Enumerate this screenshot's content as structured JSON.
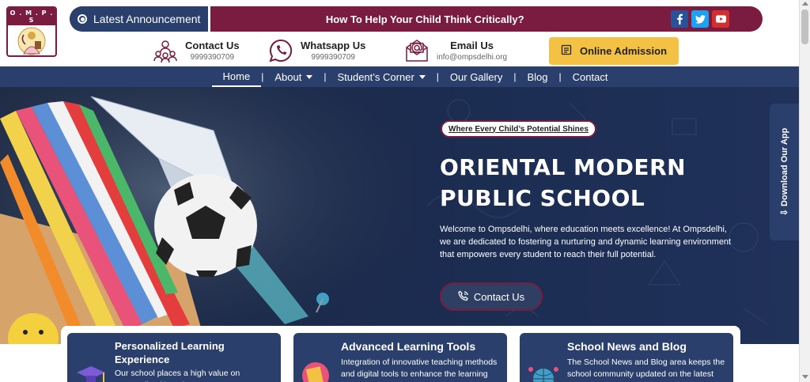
{
  "logo": {
    "top_text": "O . M . P . S",
    "bottom_text": "GOVT. RECOGNISED"
  },
  "announcement": {
    "label": "Latest Announcement",
    "text": "How To Help Your Child Think Critically?"
  },
  "socials": [
    {
      "name": "facebook",
      "glyph": "f"
    },
    {
      "name": "twitter",
      "glyph": "t"
    },
    {
      "name": "youtube",
      "glyph": "▶"
    }
  ],
  "contacts": [
    {
      "title": "Contact Us",
      "sub": "9999390709"
    },
    {
      "title": "Whatsapp Us",
      "sub": "9999390709"
    },
    {
      "title": "Email Us",
      "sub": "info@ompsdelhi.org"
    }
  ],
  "admission_button": "Online Admission",
  "nav": [
    {
      "label": "Home",
      "active": true,
      "dropdown": false
    },
    {
      "label": "About",
      "active": false,
      "dropdown": true
    },
    {
      "label": "Student’s Corner",
      "active": false,
      "dropdown": true
    },
    {
      "label": "Our Gallery",
      "active": false,
      "dropdown": false
    },
    {
      "label": "Blog",
      "active": false,
      "dropdown": false
    },
    {
      "label": "Contact",
      "active": false,
      "dropdown": false
    }
  ],
  "hero": {
    "tagline": "Where Every Child’s Potential Shines",
    "title_line1": "ORIENTAL MODERN",
    "title_line2": "PUBLIC SCHOOL",
    "description": "Welcome to Ompsdelhi, where education meets excellence! At Ompsdelhi, we are dedicated to fostering a nurturing and dynamic learning environment that empowers every student to reach their full potential.",
    "button": "Contact Us"
  },
  "download_app": "Download Our App",
  "cards": [
    {
      "title": "Personalized Learning Experience",
      "desc": "Our school places a high value on personalized learning..."
    },
    {
      "title": "Advanced Learning Tools",
      "desc": "Integration of innovative teaching methods and digital tools to enhance the learning experience..."
    },
    {
      "title": "School News and Blog",
      "desc": "The School News and Blog area keeps the school community updated on the latest happenings..."
    }
  ],
  "colors": {
    "maroon": "#7a1c40",
    "navy": "#2a3f6b",
    "gold": "#f3c244"
  }
}
